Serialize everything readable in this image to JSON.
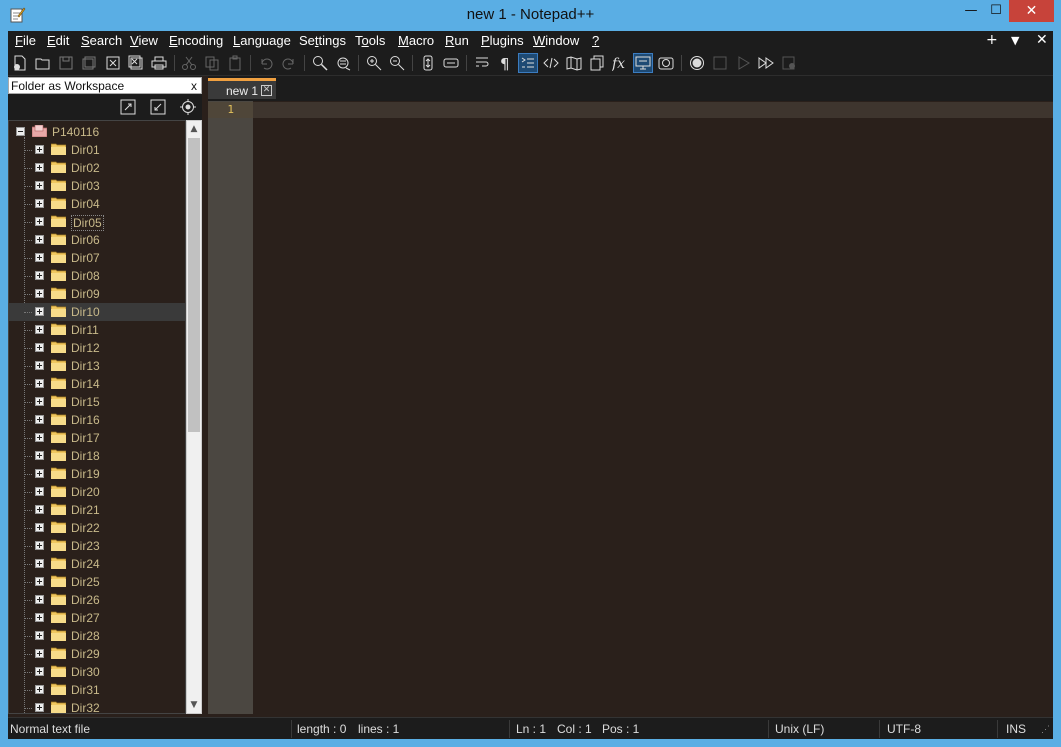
{
  "window": {
    "title": "new 1 - Notepad++",
    "minimize": "—",
    "maximize": "☐",
    "close": "✕"
  },
  "menu": {
    "items": [
      {
        "pre": "",
        "u": "F",
        "post": "ile"
      },
      {
        "pre": "",
        "u": "E",
        "post": "dit"
      },
      {
        "pre": "",
        "u": "S",
        "post": "earch"
      },
      {
        "pre": "",
        "u": "V",
        "post": "iew"
      },
      {
        "pre": "",
        "u": "E",
        "post": "ncoding"
      },
      {
        "pre": "",
        "u": "L",
        "post": "anguage"
      },
      {
        "pre": "Se",
        "u": "t",
        "post": "tings"
      },
      {
        "pre": "T",
        "u": "o",
        "post": "ols"
      },
      {
        "pre": "",
        "u": "M",
        "post": "acro"
      },
      {
        "pre": "",
        "u": "R",
        "post": "un"
      },
      {
        "pre": "",
        "u": "P",
        "post": "lugins"
      },
      {
        "pre": "",
        "u": "W",
        "post": "indow"
      },
      {
        "pre": "",
        "u": "?",
        "post": ""
      }
    ],
    "right": [
      "+",
      "▼",
      "✕"
    ]
  },
  "panel": {
    "title": "Folder as Workspace",
    "close": "x",
    "root": "P140116",
    "folders": [
      "Dir01",
      "Dir02",
      "Dir03",
      "Dir04",
      "Dir05",
      "Dir06",
      "Dir07",
      "Dir08",
      "Dir09",
      "Dir10",
      "Dir11",
      "Dir12",
      "Dir13",
      "Dir14",
      "Dir15",
      "Dir16",
      "Dir17",
      "Dir18",
      "Dir19",
      "Dir20",
      "Dir21",
      "Dir22",
      "Dir23",
      "Dir24",
      "Dir25",
      "Dir26",
      "Dir27",
      "Dir28",
      "Dir29",
      "Dir30",
      "Dir31",
      "Dir32"
    ],
    "focused": "Dir05",
    "selected": "Dir10"
  },
  "tabs": [
    {
      "label": "new 1"
    }
  ],
  "editor": {
    "line_numbers": [
      "1"
    ]
  },
  "status": {
    "type": "Normal text file",
    "length": "length : 0",
    "lines": "lines : 1",
    "ln": "Ln : 1",
    "col": "Col : 1",
    "pos": "Pos : 1",
    "eol": "Unix (LF)",
    "encoding": "UTF-8",
    "mode": "INS"
  },
  "colors": {
    "titlebar": "#5aaee4",
    "editor_bg": "#2a201b",
    "gutter_bg": "#4b4741",
    "line_number": "#e3c25c",
    "tab_accent": "#f0a040",
    "close_button": "#c7433a"
  }
}
